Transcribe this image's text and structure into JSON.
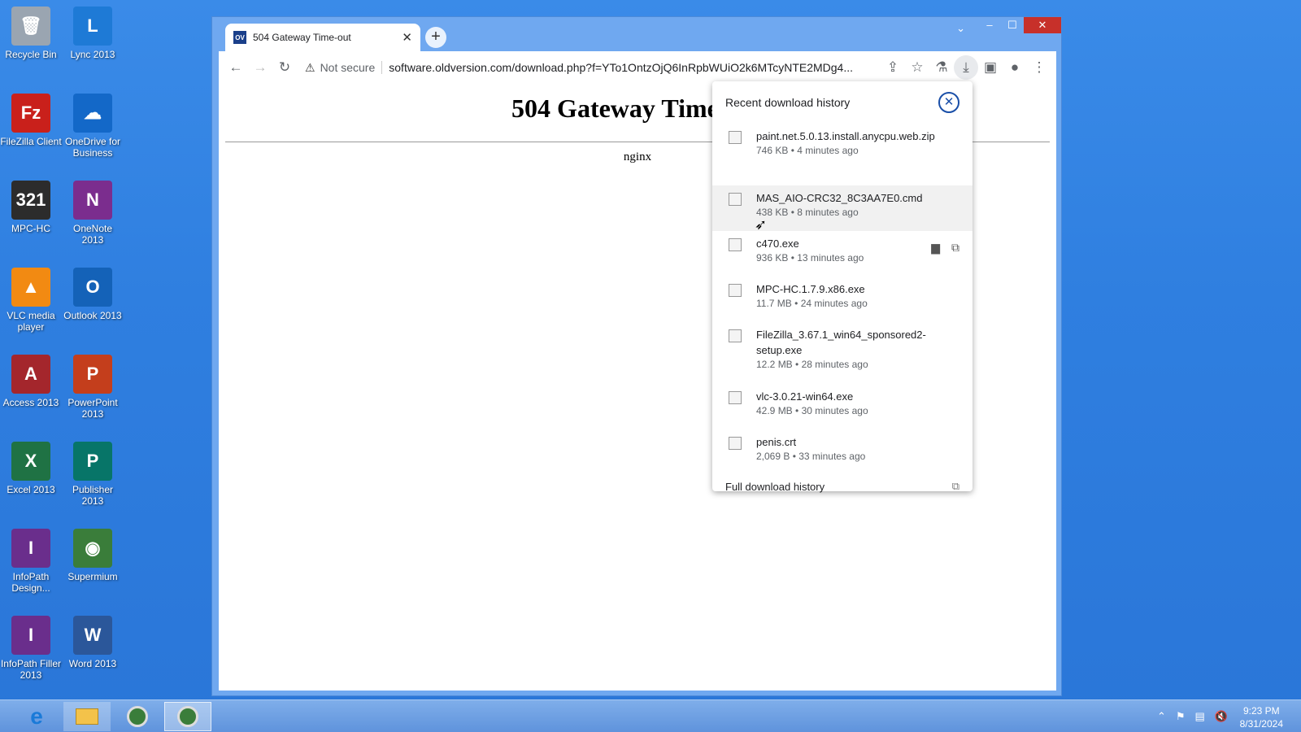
{
  "desktop": {
    "icons": [
      {
        "label": "Recycle Bin",
        "color": "#9aa5b1",
        "glyph": "🗑"
      },
      {
        "label": "Lync 2013",
        "color": "#1e7ad6",
        "glyph": "L"
      },
      {
        "label": "FileZilla Client",
        "color": "#c9201b",
        "glyph": "Fz"
      },
      {
        "label": "OneDrive for Business",
        "color": "#1368c8",
        "glyph": "☁"
      },
      {
        "label": "MPC-HC",
        "color": "#2c2c2c",
        "glyph": "321"
      },
      {
        "label": "OneNote 2013",
        "color": "#7b2d8e",
        "glyph": "N"
      },
      {
        "label": "VLC media player",
        "color": "#f28a12",
        "glyph": "▲"
      },
      {
        "label": "Outlook 2013",
        "color": "#1462b8",
        "glyph": "O"
      },
      {
        "label": "Access 2013",
        "color": "#a4262c",
        "glyph": "A"
      },
      {
        "label": "PowerPoint 2013",
        "color": "#c43e1c",
        "glyph": "P"
      },
      {
        "label": "Excel 2013",
        "color": "#1f7244",
        "glyph": "X"
      },
      {
        "label": "Publisher 2013",
        "color": "#077568",
        "glyph": "P"
      },
      {
        "label": "InfoPath Design...",
        "color": "#6a2e8c",
        "glyph": "I"
      },
      {
        "label": "Supermium",
        "color": "#3a7d3a",
        "glyph": "◉"
      },
      {
        "label": "InfoPath Filler 2013",
        "color": "#6a2e8c",
        "glyph": "I"
      },
      {
        "label": "Word 2013",
        "color": "#2b579a",
        "glyph": "W"
      }
    ]
  },
  "browser": {
    "tab": {
      "favicon": "OV",
      "title": "504 Gateway Time-out",
      "close": "✕"
    },
    "new_tab": "+",
    "window_controls": {
      "minimize": "–",
      "maximize": "☐",
      "close": "✕"
    },
    "address": {
      "not_secure": "Not secure",
      "url": "software.oldversion.com/download.php?f=YTo1OntzOjQ6InRpbWUiO2k6MTcyNTE2MDg4..."
    },
    "page": {
      "heading": "504 Gateway Time-out",
      "server": "nginx"
    }
  },
  "downloads": {
    "title": "Recent download history",
    "items": [
      {
        "name": "paint.net.5.0.13.install.anycpu.web.zip",
        "size": "746 KB",
        "time": "4 minutes ago",
        "icon": "zip"
      },
      {
        "name": "MAS_AIO-CRC32_8C3AA7E0.cmd",
        "size": "438 KB",
        "time": "8 minutes ago",
        "icon": "cmd"
      },
      {
        "name": "c470.exe",
        "size": "936 KB",
        "time": "13 minutes ago",
        "icon": "exe"
      },
      {
        "name": "MPC-HC.1.7.9.x86.exe",
        "size": "11.7 MB",
        "time": "24 minutes ago",
        "icon": "mpc"
      },
      {
        "name": "FileZilla_3.67.1_win64_sponsored2-setup.exe",
        "size": "12.2 MB",
        "time": "28 minutes ago",
        "icon": "fz"
      },
      {
        "name": "vlc-3.0.21-win64.exe",
        "size": "42.9 MB",
        "time": "30 minutes ago",
        "icon": "vlc"
      },
      {
        "name": "penis.crt",
        "size": "2,069 B",
        "time": "33 minutes ago",
        "icon": "crt"
      }
    ],
    "full_history": "Full download history"
  },
  "taskbar": {
    "clock_time": "9:23 PM",
    "clock_date": "8/31/2024"
  }
}
